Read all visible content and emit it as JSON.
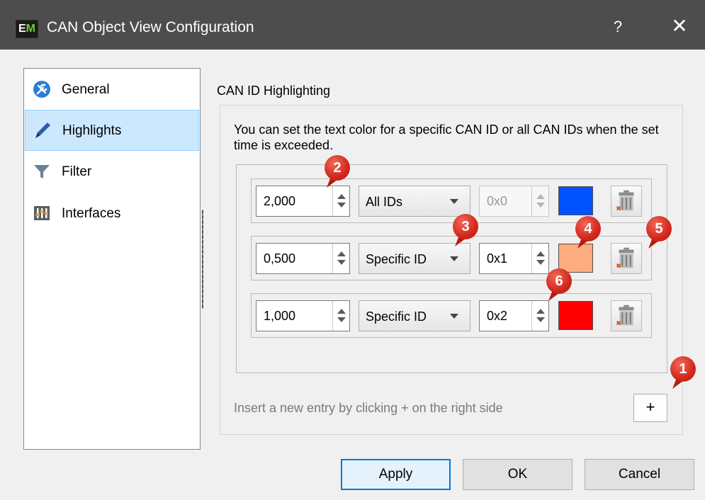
{
  "window": {
    "icon_text_e": "E",
    "icon_text_m": "M",
    "title": "CAN Object View Configuration",
    "help_label": "?",
    "close_label": "✕"
  },
  "sidebar": {
    "items": [
      {
        "label": "General",
        "icon": "general-icon"
      },
      {
        "label": "Highlights",
        "icon": "pencil-icon",
        "selected": true
      },
      {
        "label": "Filter",
        "icon": "funnel-icon"
      },
      {
        "label": "Interfaces",
        "icon": "interfaces-icon"
      }
    ]
  },
  "group": {
    "title": "CAN ID Highlighting",
    "description": "You can set the text color for a specific CAN ID or all CAN IDs when the set time is exceeded."
  },
  "entries": [
    {
      "time": "2,000",
      "mode": "All IDs",
      "id": "0x0",
      "id_enabled": false,
      "color": "#0052ff"
    },
    {
      "time": "0,500",
      "mode": "Specific ID",
      "id": "0x1",
      "id_enabled": true,
      "color": "#ffad80"
    },
    {
      "time": "1,000",
      "mode": "Specific ID",
      "id": "0x2",
      "id_enabled": true,
      "color": "#ff0000"
    }
  ],
  "hint": "Insert a new entry by clicking + on the right side",
  "add_label": "+",
  "buttons": {
    "apply": "Apply",
    "ok": "OK",
    "cancel": "Cancel"
  },
  "markers": [
    "1",
    "2",
    "3",
    "4",
    "5",
    "6"
  ],
  "colors": {
    "titlebar": "#4d4d4d",
    "selection": "#cce8ff",
    "marker": "#d3271c",
    "focus": "#0078d7"
  }
}
